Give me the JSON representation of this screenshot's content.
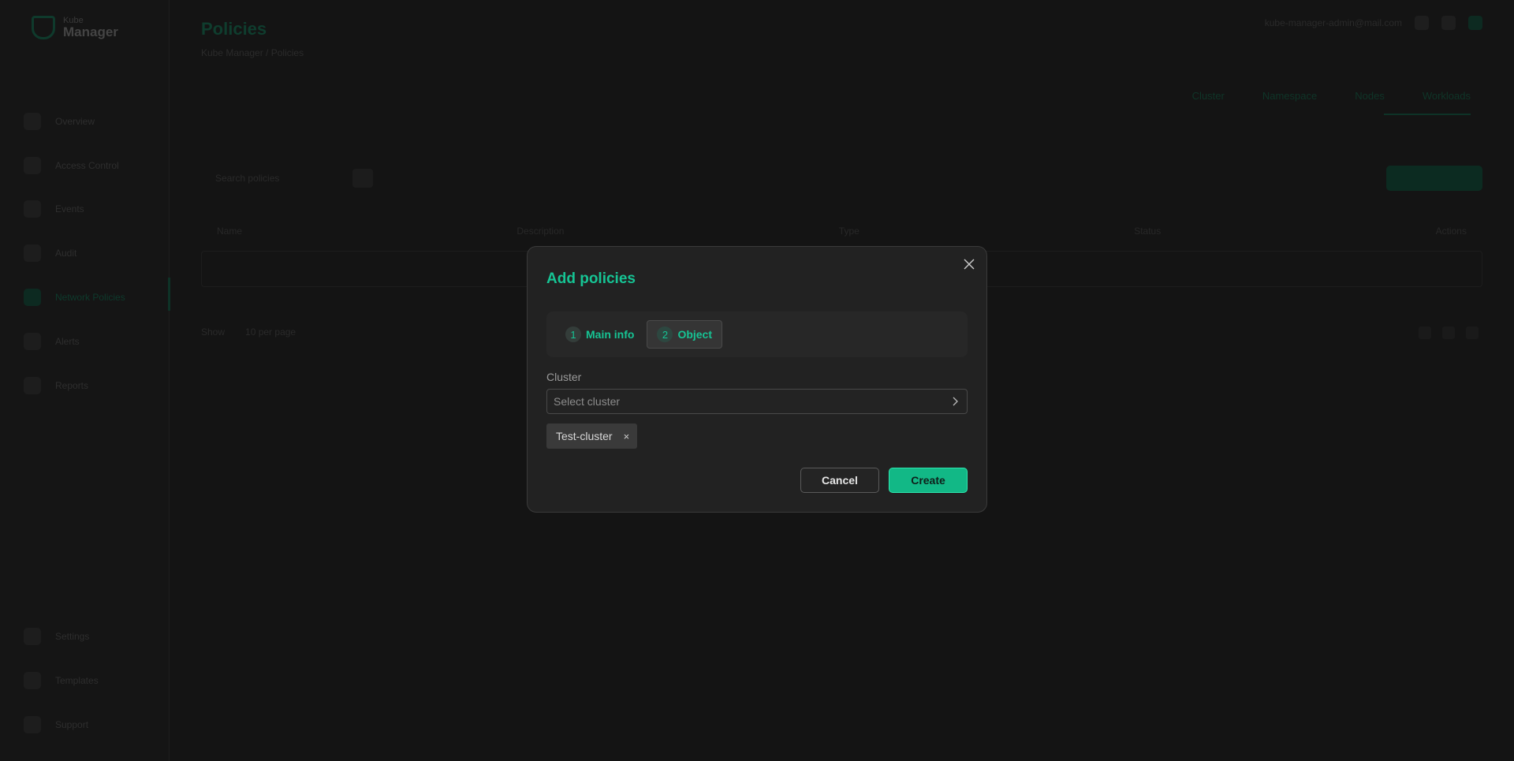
{
  "background": {
    "logo": {
      "small": "Kube",
      "big": "Manager"
    },
    "page_title": "Policies",
    "breadcrumb": "Kube Manager / Policies",
    "top_right_text": "kube-manager-admin@mail.com",
    "sidebar_items": [
      "Overview",
      "Access Control",
      "Events",
      "Audit",
      "Network Policies",
      "Alerts",
      "Reports"
    ],
    "sidebar_bottom_items": [
      "Settings",
      "Templates",
      "Support"
    ],
    "tabs": [
      "Cluster",
      "Namespace",
      "Nodes",
      "Workloads"
    ],
    "search_placeholder": "Search policies",
    "table_columns": [
      "Name",
      "Description",
      "Type",
      "Status",
      "Actions"
    ],
    "pager_label": "Show",
    "pager_value": "10 per page"
  },
  "modal": {
    "title": "Add policies",
    "steps": [
      {
        "number": "1",
        "label": "Main info"
      },
      {
        "number": "2",
        "label": "Object"
      }
    ],
    "cluster_label": "Cluster",
    "cluster_placeholder": "Select cluster",
    "selected_tags": [
      "Test-cluster"
    ],
    "tag_remove_glyph": "×",
    "cancel_label": "Cancel",
    "create_label": "Create"
  },
  "colors": {
    "accent": "#16c494",
    "create_bg": "#12b886",
    "modal_bg": "#222222",
    "page_bg": "#141414"
  },
  "icons": {
    "close": "close-icon",
    "chevron": "chevron-right-icon"
  }
}
